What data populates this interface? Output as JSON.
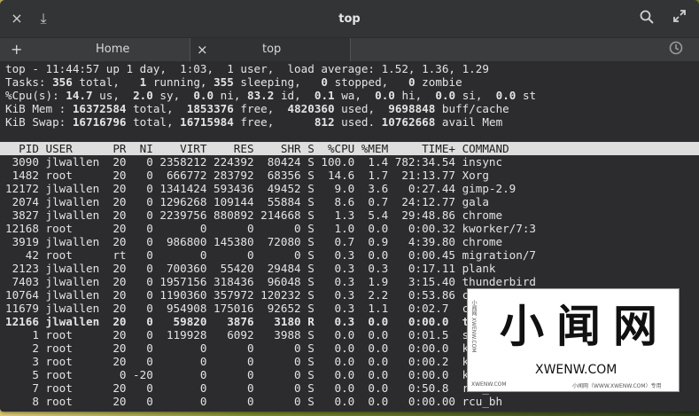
{
  "window": {
    "title": "top"
  },
  "titlebar": {
    "close_icon": "×",
    "download_icon": "⤓",
    "search_icon": "search",
    "fullscreen_icon": "expand"
  },
  "tabs": [
    {
      "label": "Home",
      "icon": "+",
      "icon_name": "add-icon"
    },
    {
      "label": "top",
      "icon": "×",
      "icon_name": "close-icon"
    }
  ],
  "summary": {
    "line1": "top - 11:44:57 up 1 day,  1:03,  1 user,  load average: 1.52, 1.36, 1.29",
    "tasks": {
      "p1": "Tasks: ",
      "total": "356",
      "p2": " total,   ",
      "running": "1",
      "p3": " running, ",
      "sleeping": "355",
      "p4": " sleeping,   ",
      "stopped": "0",
      "p5": " stopped,   ",
      "zombie": "0",
      "p6": " zombie"
    },
    "cpu": {
      "p1": "%Cpu(s): ",
      "us": "14.7",
      "p2": " us,  ",
      "sy": "2.0",
      "p3": " sy,  ",
      "ni": "0.0",
      "p4": " ni, ",
      "id": "83.2",
      "p5": " id,  ",
      "wa": "0.1",
      "p6": " wa,  ",
      "hi": "0.0",
      "p7": " hi,  ",
      "si": "0.0",
      "p8": " si,  ",
      "st": "0.0",
      "p9": " st"
    },
    "mem": {
      "p1": "KiB Mem : ",
      "total": "16372584",
      "p2": " total,  ",
      "free": "1853376",
      "p3": " free,  ",
      "used": "4820360",
      "p4": " used,  ",
      "buff": "9698848",
      "p5": " buff/cache"
    },
    "swap": {
      "p1": "KiB Swap: ",
      "total": "16716796",
      "p2": " total, ",
      "free": "16715984",
      "p3": " free,      ",
      "used": "812",
      "p4": " used. ",
      "avail": "10762668",
      "p5": " avail Mem"
    }
  },
  "table": {
    "header": "  PID USER      PR  NI    VIRT    RES    SHR S  %CPU %MEM     TIME+ COMMAND",
    "rows": [
      " 3090 jlwallen  20   0 2358212 224392  80424 S 100.0  1.4 782:34.54 insync",
      " 1482 root      20   0  666772 283792  68356 S  14.6  1.7  21:13.77 Xorg",
      "12172 jlwallen  20   0 1341424 593436  49452 S   9.0  3.6   0:27.44 gimp-2.9",
      " 2074 jlwallen  20   0 1296268 109144  55884 S   8.6  0.7  24:12.77 gala",
      " 3827 jlwallen  20   0 2239756 880892 214668 S   1.3  5.4  29:48.86 chrome",
      "12168 root      20   0       0      0      0 S   1.0  0.0   0:00.32 kworker/7:3",
      " 3919 jlwallen  20   0  986800 145380  72080 S   0.7  0.9   4:39.80 chrome",
      "   42 root      rt   0       0      0      0 S   0.3  0.0   0:00.45 migration/7",
      " 2123 jlwallen  20   0  700360  55420  29484 S   0.3  0.3   0:17.11 plank",
      " 7403 jlwallen  20   0 1957156 318436  96048 S   0.3  1.9   3:15.40 thunderbird",
      "10764 jlwallen  20   0 1190360 357972 120232 S   0.3  2.2   0:53.86 chrome",
      "11679 jlwallen  20   0  954908 175016  92652 S   0.3  1.1   0:02.7  chrome",
      "12166 jlwallen  20   0   59820   3876   3180 R   0.3  0.0   0:00.0  top",
      "    1 root      20   0  119928   6092   3988 S   0.0  0.0   0:01.5  systemd",
      "    2 root      20   0       0      0      0 S   0.0  0.0   0:00.0  kthreadd",
      "    3 root      20   0       0      0      0 S   0.0  0.0   0:00.2  ksoftirqd/0",
      "    5 root       0 -20       0      0      0 S   0.0  0.0   0:00.0  kworker/0:0H",
      "    7 root      20   0       0      0      0 S   0.0  0.0   0:50.8  rcu_sched",
      "    8 root      20   0       0      0      0 S   0.0  0.0   0:00.00 rcu_bh"
    ],
    "bold_row_index": 12
  },
  "watermark": {
    "big": "小闻网",
    "url": "XWENW.COM",
    "side": "小闻网 XWENW.COM",
    "small_left": "XWENW.COM",
    "small_right": "小闻网（WWW.XWENW.COM）专用"
  },
  "colors": {
    "terminal_bg": "#2c2c2e",
    "terminal_fg": "#e4e4e4",
    "header_bg": "#dedede",
    "titlebar_bg": "#323436"
  }
}
